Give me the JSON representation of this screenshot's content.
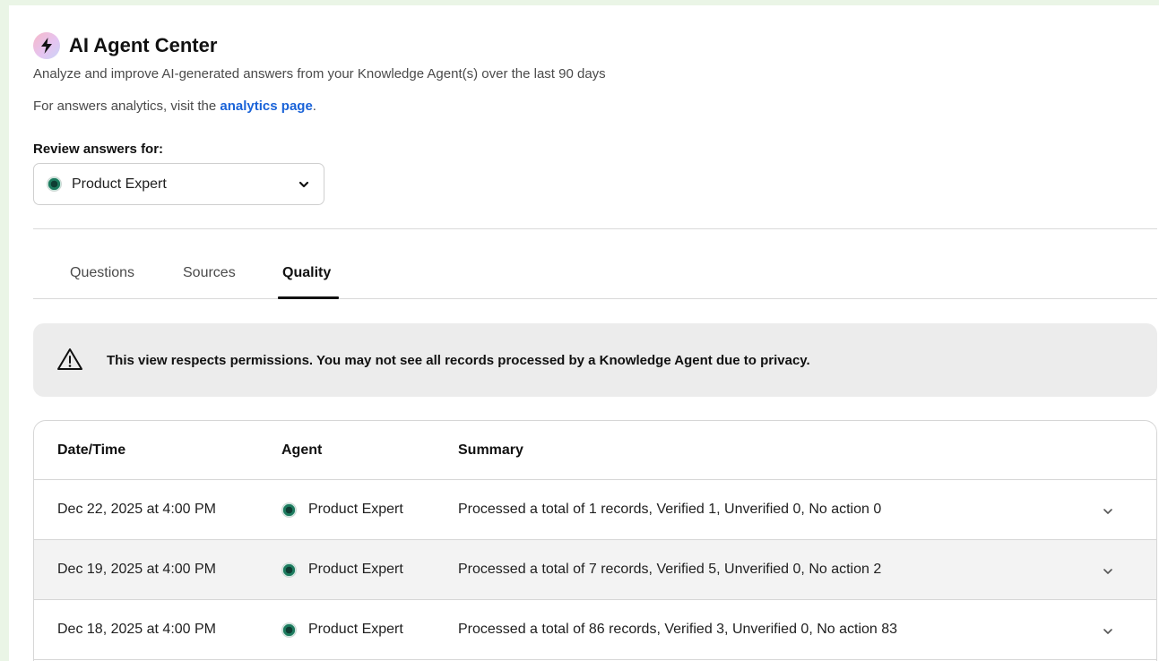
{
  "header": {
    "icon": "lightning-icon",
    "title": "AI Agent Center",
    "subtitle": "Analyze and improve AI-generated answers from your Knowledge Agent(s) over the last 90 days",
    "analytics_prefix": "For answers analytics, visit the ",
    "analytics_link": "analytics page",
    "analytics_suffix": "."
  },
  "review": {
    "label": "Review answers for:",
    "selected_agent": "Product Expert"
  },
  "tabs": [
    {
      "label": "Questions",
      "active": false
    },
    {
      "label": "Sources",
      "active": false
    },
    {
      "label": "Quality",
      "active": true
    }
  ],
  "notice": {
    "icon": "warning-triangle-icon",
    "text": "This view respects permissions. You may not see all records processed by a Knowledge Agent due to privacy."
  },
  "table": {
    "columns": [
      "Date/Time",
      "Agent",
      "Summary"
    ],
    "rows": [
      {
        "datetime": "Dec 22, 2025 at 4:00 PM",
        "agent": "Product Expert",
        "summary": "Processed a total of 1 records, Verified 1, Unverified 0, No action 0"
      },
      {
        "datetime": "Dec 19, 2025 at 4:00 PM",
        "agent": "Product Expert",
        "summary": "Processed a total of 7 records, Verified 5, Unverified 0, No action 2"
      },
      {
        "datetime": "Dec 18, 2025 at 4:00 PM",
        "agent": "Product Expert",
        "summary": "Processed a total of 86 records, Verified 3, Unverified 0, No action 83"
      }
    ]
  },
  "colors": {
    "link": "#1a63d8",
    "notice_bg": "#ececec",
    "row_alt_bg": "#f3f3f3",
    "outer_bg": "#eaf5e6"
  }
}
